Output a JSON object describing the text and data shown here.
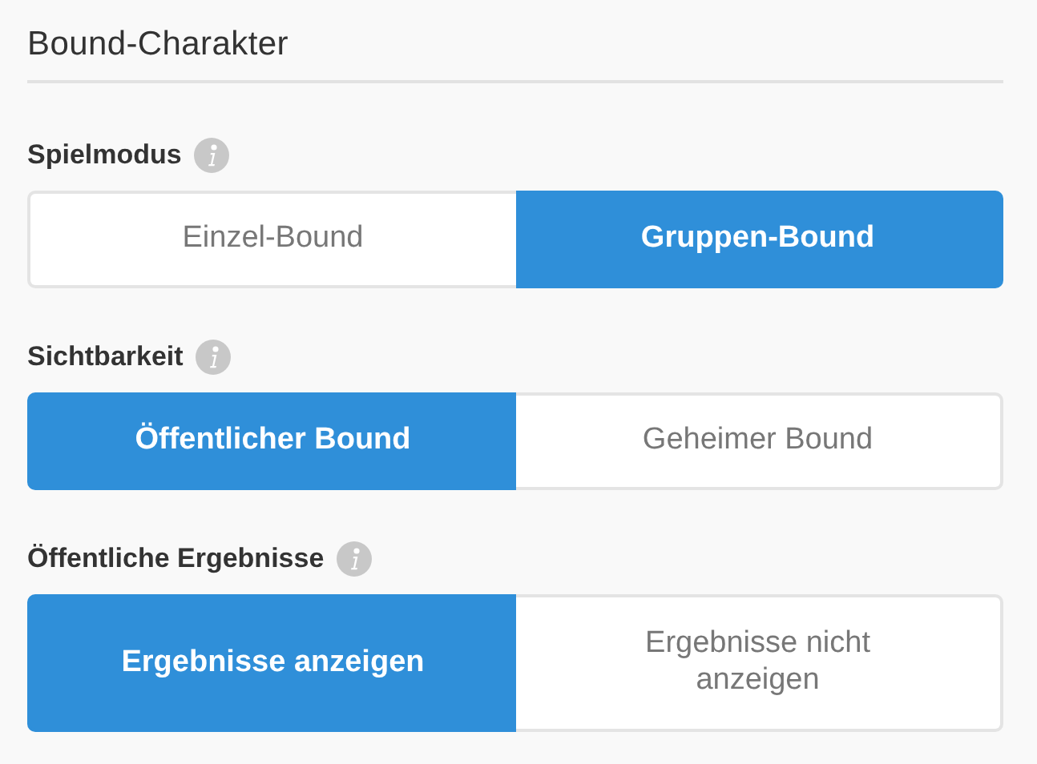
{
  "title": "Bound-Charakter",
  "sections": [
    {
      "label": "Spielmodus",
      "options": [
        {
          "label": "Einzel-Bound",
          "selected": false
        },
        {
          "label": "Gruppen-Bound",
          "selected": true
        }
      ]
    },
    {
      "label": "Sichtbarkeit",
      "options": [
        {
          "label": "Öffentlicher Bound",
          "selected": true
        },
        {
          "label": "Geheimer Bound",
          "selected": false
        }
      ]
    },
    {
      "label": "Öffentliche Ergebnisse",
      "options": [
        {
          "label": "Ergebnisse anzeigen",
          "selected": true
        },
        {
          "label": "Ergebnisse nicht anzeigen",
          "selected": false
        }
      ]
    }
  ]
}
